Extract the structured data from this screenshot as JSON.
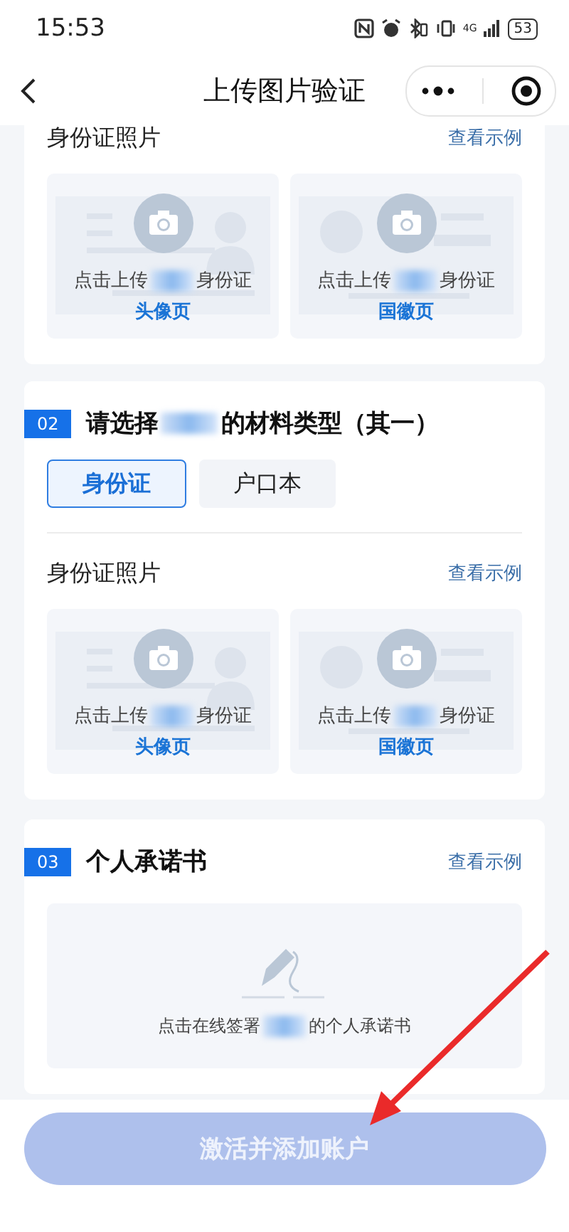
{
  "status_bar": {
    "time": "15:53",
    "network": "4G",
    "battery": "53"
  },
  "nav": {
    "title": "上传图片验证"
  },
  "sections": [
    {
      "kind": "partial",
      "photos": {
        "title": "身份证照片",
        "link": "查看示例",
        "tiles": [
          {
            "kind": "portrait",
            "prefix": "点击上传",
            "suffix": "身份证",
            "side": "头像页"
          },
          {
            "kind": "emblem",
            "prefix": "点击上传",
            "suffix": "身份证",
            "side": "国徽页"
          }
        ]
      }
    },
    {
      "kind": "choice",
      "number": "02",
      "title_prefix": "请选择",
      "title_suffix": "的材料类型（其一）",
      "options": [
        {
          "label": "身份证",
          "selected": true
        },
        {
          "label": "户口本",
          "selected": false
        }
      ],
      "photos": {
        "title": "身份证照片",
        "link": "查看示例",
        "tiles": [
          {
            "kind": "portrait",
            "prefix": "点击上传",
            "suffix": "身份证",
            "side": "头像页"
          },
          {
            "kind": "emblem",
            "prefix": "点击上传",
            "suffix": "身份证",
            "side": "国徽页"
          }
        ]
      }
    },
    {
      "kind": "sign",
      "number": "03",
      "title": "个人承诺书",
      "link": "查看示例",
      "sign": {
        "prefix": "点击在线签署",
        "suffix": "的个人承诺书"
      }
    }
  ],
  "button": {
    "label": "激活并添加账户",
    "disabled": true
  }
}
